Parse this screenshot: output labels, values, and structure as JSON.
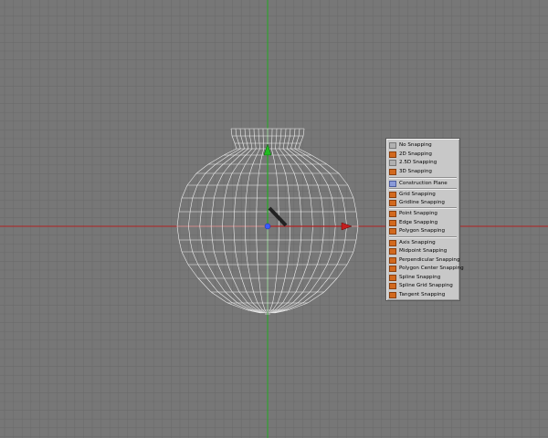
{
  "snapping_menu": {
    "items": [
      {
        "label": "No Snapping",
        "icon": "no-snap-icon",
        "color": "grey"
      },
      {
        "label": "2D Snapping",
        "icon": "snap-2d-icon",
        "color": "orange"
      },
      {
        "label": "2.5D Snapping",
        "icon": "snap-25d-icon",
        "color": "grey"
      },
      {
        "label": "3D Snapping",
        "icon": "snap-3d-icon",
        "color": "orange"
      },
      {
        "label": "Construction Plane",
        "icon": "construction-plane-icon",
        "color": "blue"
      },
      {
        "label": "Grid Snapping",
        "icon": "grid-snap-icon",
        "color": "orange"
      },
      {
        "label": "Gridline Snapping",
        "icon": "gridline-snap-icon",
        "color": "orange"
      },
      {
        "label": "Point Snapping",
        "icon": "point-snap-icon",
        "color": "orange"
      },
      {
        "label": "Edge Snapping",
        "icon": "edge-snap-icon",
        "color": "orange"
      },
      {
        "label": "Polygon Snapping",
        "icon": "polygon-snap-icon",
        "color": "orange"
      },
      {
        "label": "Axis Snapping",
        "icon": "axis-snap-icon",
        "color": "orange"
      },
      {
        "label": "Midpoint Snapping",
        "icon": "midpoint-snap-icon",
        "color": "orange"
      },
      {
        "label": "Perpendicular Snapping",
        "icon": "perpendicular-snap-icon",
        "color": "orange"
      },
      {
        "label": "Polygon Center Snapping",
        "icon": "polygon-center-snap-icon",
        "color": "orange"
      },
      {
        "label": "Spline Snapping",
        "icon": "spline-snap-icon",
        "color": "orange"
      },
      {
        "label": "Spline Grid Snapping",
        "icon": "spline-grid-snap-icon",
        "color": "orange"
      },
      {
        "label": "Tangent Snapping",
        "icon": "tangent-snap-icon",
        "color": "orange"
      }
    ]
  },
  "colors": {
    "viewport_bg": "#777777",
    "grid_line": "#6b6b6b",
    "x_axis": "#b22222",
    "y_axis": "#22aa22",
    "wireframe": "#f0f0f0",
    "pivot": "#3b5bff",
    "menu_bg": "#c8c8c8"
  }
}
